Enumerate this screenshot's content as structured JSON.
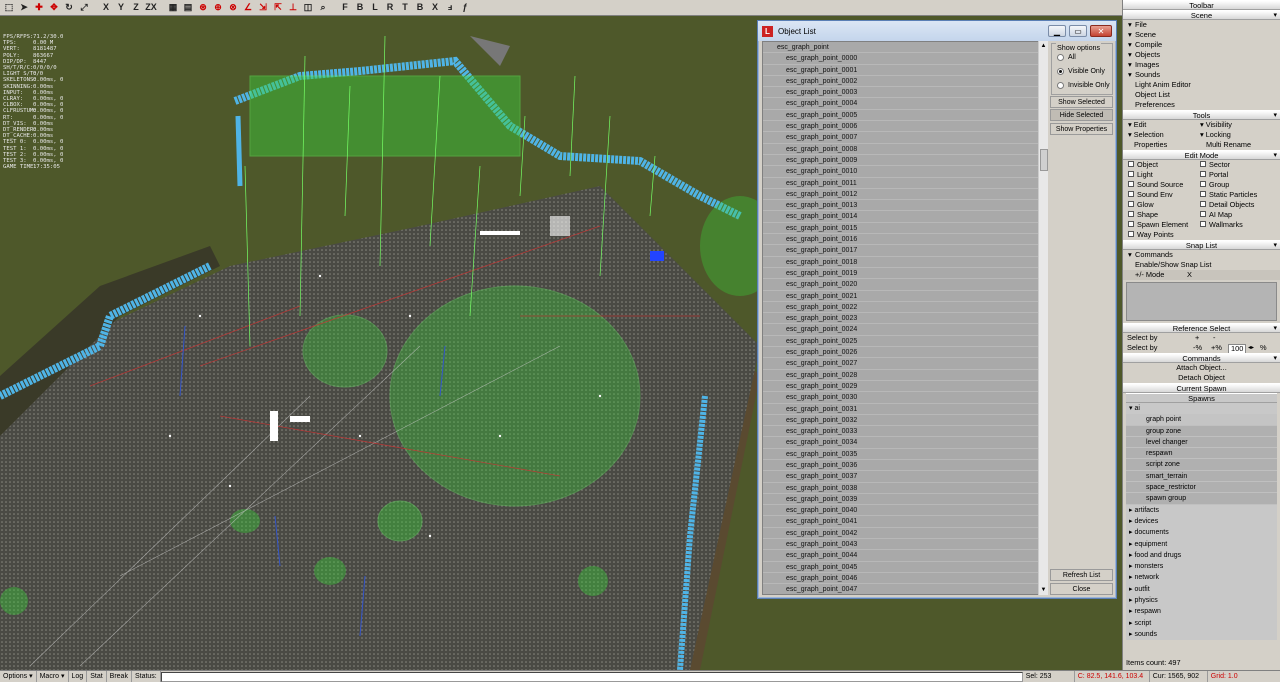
{
  "toolbar_top": {
    "letters": [
      "X",
      "Y",
      "Z",
      "ZX"
    ],
    "letters2": [
      "F",
      "B",
      "L",
      "R",
      "T",
      "B",
      "X"
    ]
  },
  "stats": [
    {
      "k": "FPS/RFPS:",
      "v": "71.2/30.0"
    },
    {
      "k": "TPS:",
      "v": "0.00 M"
    },
    {
      "k": "VERT:",
      "v": "8181487"
    },
    {
      "k": "POLY:",
      "v": "863667"
    },
    {
      "k": "DIP/DP:",
      "v": "8447"
    },
    {
      "k": "SH/T/R/C:",
      "v": "0/0/0/0"
    },
    {
      "k": "LIGHT S/T:",
      "v": "0/0"
    },
    {
      "k": "SKELETONS:",
      "v": "0.00ms, 0"
    },
    {
      "k": "SKINNING:",
      "v": "0.00ms"
    },
    {
      "k": "",
      "v": ""
    },
    {
      "k": "INPUT:",
      "v": "0.00ms"
    },
    {
      "k": "CLRAY:",
      "v": "0.00ms, 0"
    },
    {
      "k": "CLBOX:",
      "v": "0.00ms, 0"
    },
    {
      "k": "CLFRUSTUM:",
      "v": "0.00ms, 0"
    },
    {
      "k": "",
      "v": ""
    },
    {
      "k": "RT:",
      "v": "0.00ms, 0"
    },
    {
      "k": "DT_VIS:",
      "v": "0.00ms"
    },
    {
      "k": "DT_RENDER:",
      "v": "0.00ms"
    },
    {
      "k": "DT_CACHE:",
      "v": "0.00ms"
    },
    {
      "k": "",
      "v": ""
    },
    {
      "k": "TEST 0:",
      "v": "0.00ms, 0"
    },
    {
      "k": "TEST 1:",
      "v": "0.00ms, 0"
    },
    {
      "k": "TEST 2:",
      "v": "0.00ms, 0"
    },
    {
      "k": "TEST 3:",
      "v": "0.00ms, 0"
    },
    {
      "k": "",
      "v": ""
    },
    {
      "k": "GAME TIME:",
      "v": "17:35:05"
    }
  ],
  "object_list": {
    "title": "Object List",
    "root": "esc_graph_point",
    "items": [
      "esc_graph_point_0000",
      "esc_graph_point_0001",
      "esc_graph_point_0002",
      "esc_graph_point_0003",
      "esc_graph_point_0004",
      "esc_graph_point_0005",
      "esc_graph_point_0006",
      "esc_graph_point_0007",
      "esc_graph_point_0008",
      "esc_graph_point_0009",
      "esc_graph_point_0010",
      "esc_graph_point_0011",
      "esc_graph_point_0012",
      "esc_graph_point_0013",
      "esc_graph_point_0014",
      "esc_graph_point_0015",
      "esc_graph_point_0016",
      "esc_graph_point_0017",
      "esc_graph_point_0018",
      "esc_graph_point_0019",
      "esc_graph_point_0020",
      "esc_graph_point_0021",
      "esc_graph_point_0022",
      "esc_graph_point_0023",
      "esc_graph_point_0024",
      "esc_graph_point_0025",
      "esc_graph_point_0026",
      "esc_graph_point_0027",
      "esc_graph_point_0028",
      "esc_graph_point_0029",
      "esc_graph_point_0030",
      "esc_graph_point_0031",
      "esc_graph_point_0032",
      "esc_graph_point_0033",
      "esc_graph_point_0034",
      "esc_graph_point_0035",
      "esc_graph_point_0036",
      "esc_graph_point_0037",
      "esc_graph_point_0038",
      "esc_graph_point_0039",
      "esc_graph_point_0040",
      "esc_graph_point_0041",
      "esc_graph_point_0042",
      "esc_graph_point_0043",
      "esc_graph_point_0044",
      "esc_graph_point_0045",
      "esc_graph_point_0046",
      "esc_graph_point_0047"
    ],
    "show_options": "Show options",
    "opt_all": "All",
    "opt_visible": "Visible Only",
    "opt_invisible": "Invisible Only",
    "selected_option": "Visible Only",
    "show_selected": "Show Selected",
    "hide_selected": "Hide Selected",
    "show_properties": "Show Properties",
    "refresh_list": "Refresh List",
    "close": "Close"
  },
  "rpanel": {
    "toolbar": "Toolbar",
    "scene": "Scene",
    "scene_items": [
      "File",
      "Scene",
      "Compile",
      "Objects",
      "Images",
      "Sounds"
    ],
    "scene_items2": [
      "Light Anim Editor",
      "Object List",
      "Preferences"
    ],
    "tools": "Tools",
    "tools_left": [
      "Edit",
      "Selection",
      "Properties"
    ],
    "tools_right": [
      "Visibility",
      "Locking",
      "Multi Rename"
    ],
    "edit_mode": "Edit Mode",
    "edit_left": [
      "Object",
      "Light",
      "Sound Source",
      "Sound Env",
      "Glow",
      "Shape",
      "Spawn Element",
      "Way Points"
    ],
    "edit_right": [
      "Sector",
      "Portal",
      "Group",
      "Static Particles",
      "Detail Objects",
      "AI Map",
      "Wallmarks"
    ],
    "snap_list": "Snap List",
    "commands_label": "Commands",
    "enable_snap": "Enable/Show Snap List",
    "mode": "+/- Mode",
    "mode_x": "X",
    "reference_select": "Reference Select",
    "select_by": "Select by",
    "select_by_pct": "-%",
    "select_by_pct2": "+%",
    "select_by_val": "100",
    "select_by_unit": "%",
    "commands": "Commands",
    "attach": "Attach Object...",
    "detach": "Detach Object",
    "current_spawn": "Current Spawn",
    "spawns": "Spawns",
    "ai": "ai",
    "ai_items": [
      "graph point",
      "group zone",
      "level changer",
      "respawn",
      "script zone",
      "smart_terrain",
      "space_restrictor",
      "spawn group"
    ],
    "spawn_groups": [
      "artifacts",
      "devices",
      "documents",
      "equipment",
      "food and drugs",
      "monsters",
      "network",
      "outfit",
      "physics",
      "respawn",
      "script",
      "sounds"
    ],
    "items_count": "Items count: 497"
  },
  "statusbar": {
    "options": "Options",
    "macro": "Macro",
    "log": "Log",
    "stat": "Stat",
    "break": "Break",
    "status": "Status:",
    "sel": "Sel: 253",
    "coord": "C: 82.5, 141.6, 103.4",
    "cur": "Cur: 1565, 902",
    "grid": "Grid: 1.0"
  },
  "colors": {
    "panel": "#d4d0c8",
    "list": "#a9a9a9",
    "blue_fence": "#4fb4e6",
    "green_zone": "#3ad13a"
  }
}
